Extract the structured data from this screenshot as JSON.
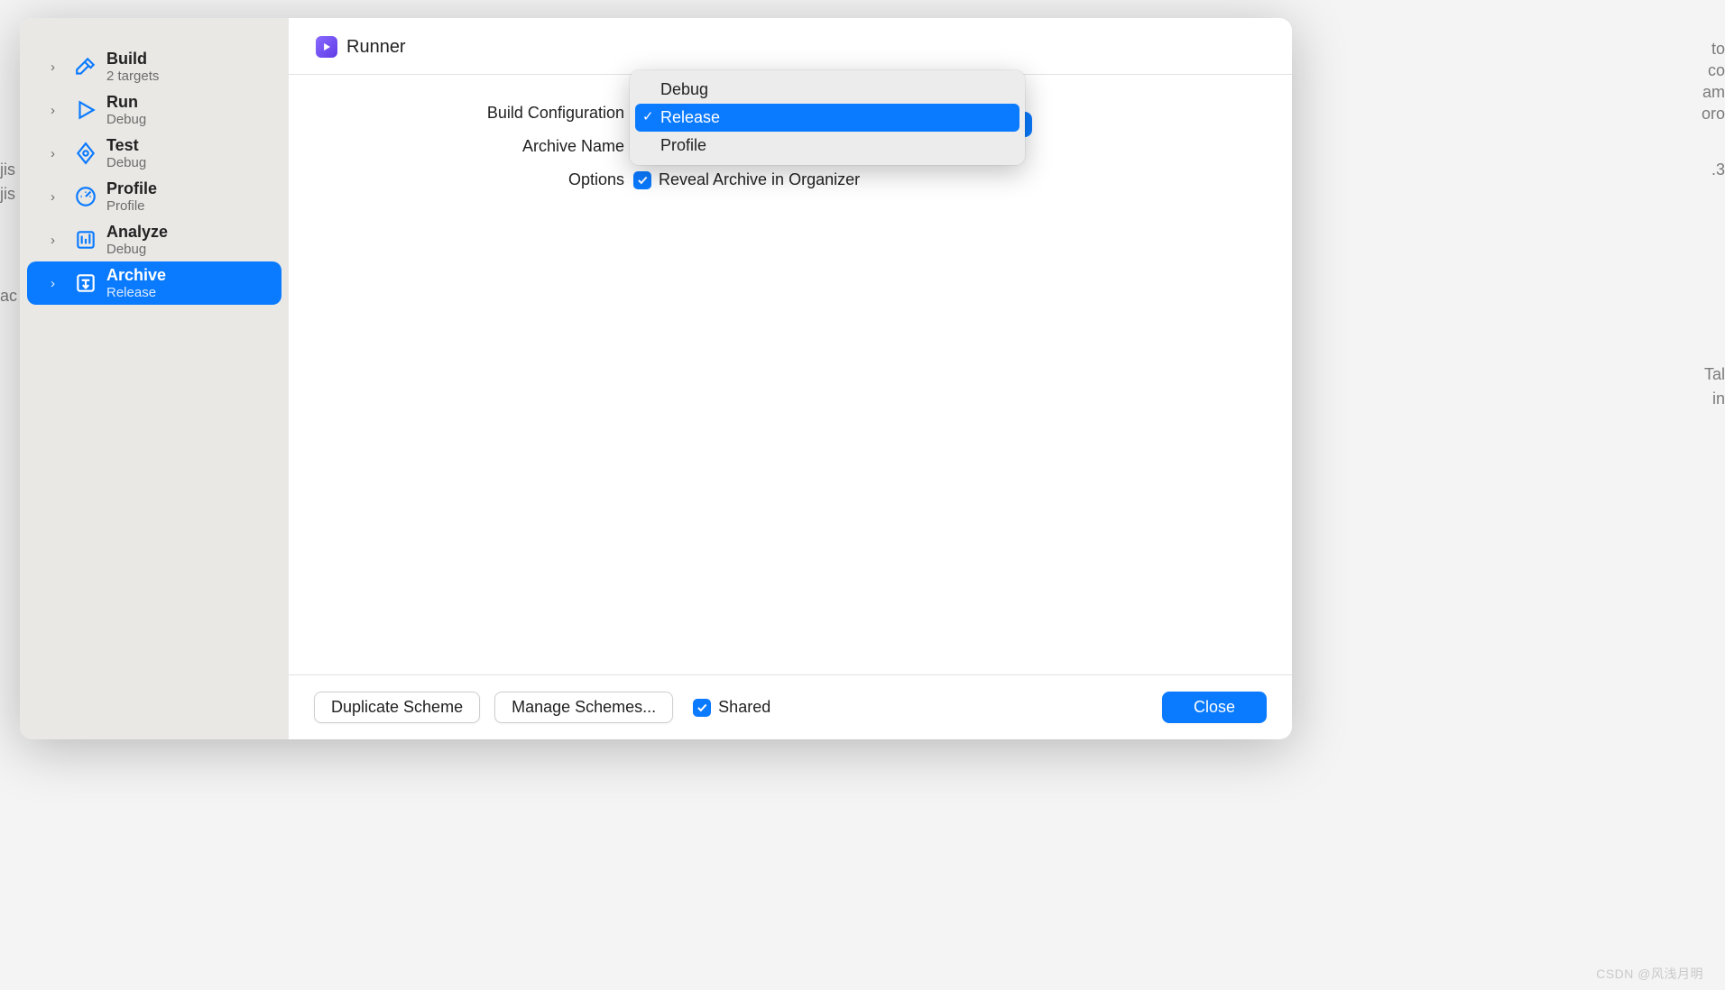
{
  "background_fragments": [
    "jis",
    "jis",
    "ac",
    "to",
    "co",
    "am",
    "oro",
    ".3",
    "Tal",
    "in"
  ],
  "scheme_name": "Runner",
  "sidebar": {
    "items": [
      {
        "label": "Build",
        "sub": "2 targets",
        "icon": "hammer"
      },
      {
        "label": "Run",
        "sub": "Debug",
        "icon": "play"
      },
      {
        "label": "Test",
        "sub": "Debug",
        "icon": "wrench-diamond"
      },
      {
        "label": "Profile",
        "sub": "Profile",
        "icon": "gauge"
      },
      {
        "label": "Analyze",
        "sub": "Debug",
        "icon": "analyze"
      },
      {
        "label": "Archive",
        "sub": "Release",
        "icon": "archive"
      }
    ],
    "selected_index": 5
  },
  "form": {
    "build_config_label": "Build Configuration",
    "archive_name_label": "Archive Name",
    "options_label": "Options",
    "reveal_label": "Reveal Archive in Organizer",
    "reveal_checked": true
  },
  "config_menu": {
    "options": [
      "Debug",
      "Release",
      "Profile"
    ],
    "selected_index": 1
  },
  "footer": {
    "duplicate": "Duplicate Scheme",
    "manage": "Manage Schemes...",
    "shared_label": "Shared",
    "shared_checked": true,
    "close": "Close"
  },
  "watermark": "CSDN @风浅月明"
}
